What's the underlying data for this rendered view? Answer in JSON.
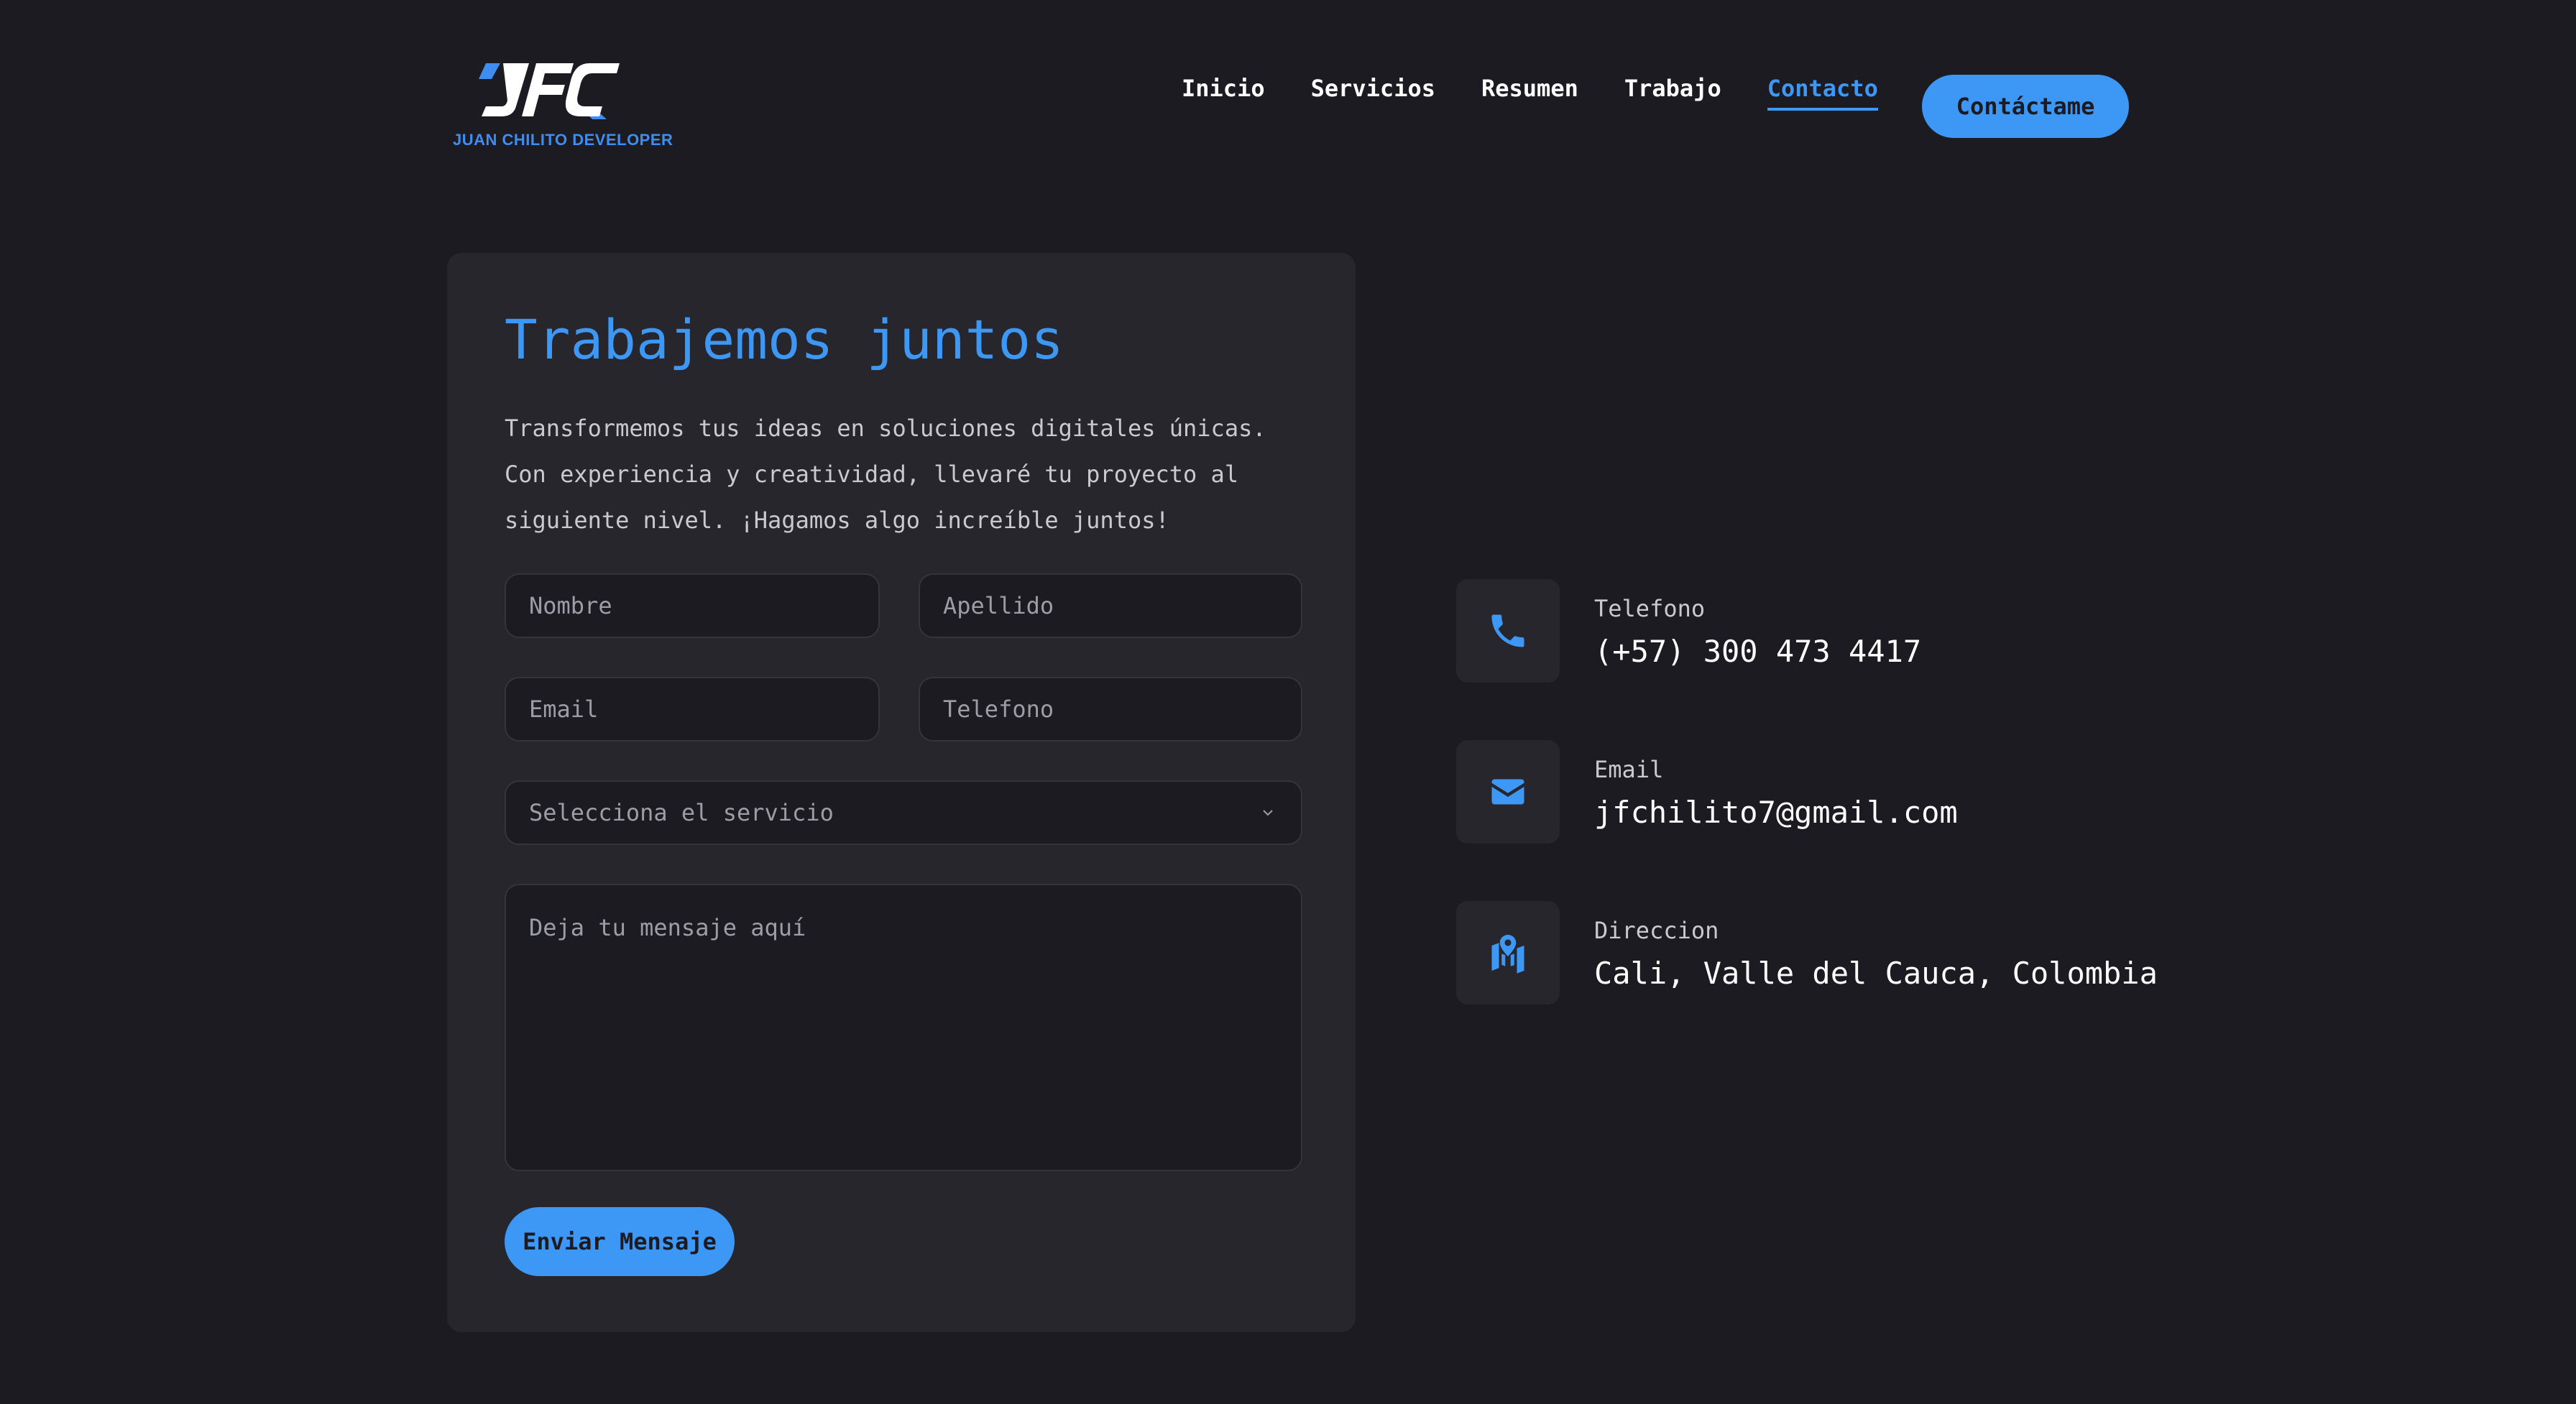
{
  "brand": {
    "logo_text": "JFC",
    "subtitle": "JUAN CHILITO DEVELOPER",
    "accent_color": "#3d97f5",
    "background_color": "#1c1b22",
    "card_color": "#27262d"
  },
  "nav": {
    "items": [
      {
        "label": "Inicio",
        "active": false
      },
      {
        "label": "Servicios",
        "active": false
      },
      {
        "label": "Resumen",
        "active": false
      },
      {
        "label": "Trabajo",
        "active": false
      },
      {
        "label": "Contacto",
        "active": true
      }
    ],
    "cta_label": "Contáctame"
  },
  "form": {
    "title": "Trabajemos juntos",
    "description": "Transformemos tus ideas en soluciones digitales únicas. Con experiencia y creatividad, llevaré tu proyecto al siguiente nivel. ¡Hagamos algo increíble juntos!",
    "first_name": {
      "value": "",
      "placeholder": "Nombre"
    },
    "last_name": {
      "value": "",
      "placeholder": "Apellido"
    },
    "email": {
      "value": "",
      "placeholder": "Email"
    },
    "phone": {
      "value": "",
      "placeholder": "Telefono"
    },
    "service_select": {
      "selected": "Selecciona el servicio",
      "icon": "chevron-down-icon"
    },
    "message": {
      "value": "",
      "placeholder": "Deja tu mensaje aquí"
    },
    "submit_label": "Enviar Mensaje"
  },
  "contact_info": [
    {
      "icon": "phone-icon",
      "label": "Telefono",
      "value": "(+57) 300 473 4417"
    },
    {
      "icon": "envelope-icon",
      "label": "Email",
      "value": "jfchilito7@gmail.com"
    },
    {
      "icon": "map-pin-icon",
      "label": "Direccion",
      "value": "Cali, Valle del Cauca, Colombia"
    }
  ]
}
